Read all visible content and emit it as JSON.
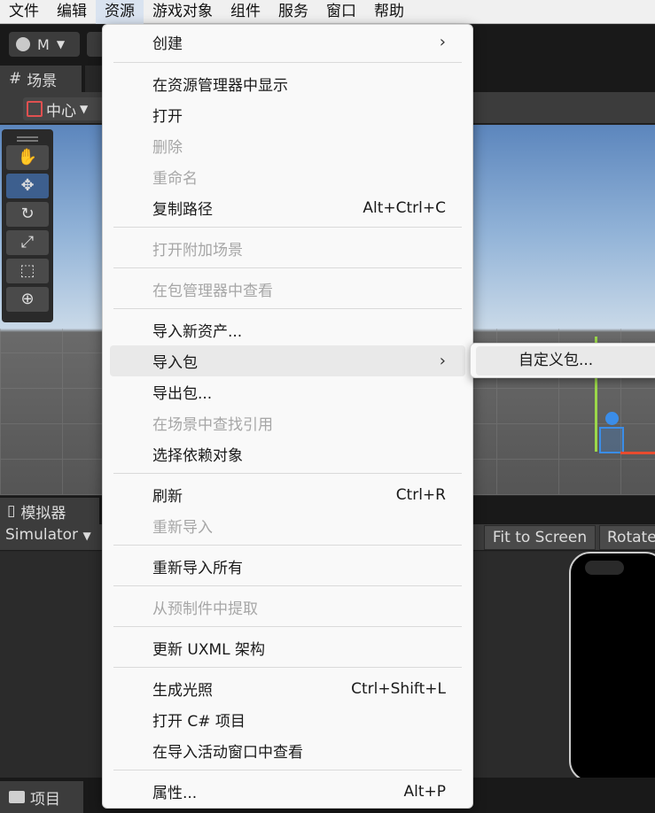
{
  "menubar": {
    "items": [
      "文件",
      "编辑",
      "资源",
      "游戏对象",
      "组件",
      "服务",
      "窗口",
      "帮助"
    ],
    "open_index": 2
  },
  "toolbar": {
    "account_label": "M"
  },
  "scene": {
    "tab_label": "场景",
    "pivot_label": "中心"
  },
  "simulator": {
    "tab_label": "模拟器",
    "selector": "Simulator",
    "fit_label": "Fit to Screen",
    "rotate_label": "Rotate"
  },
  "project": {
    "tab_label": "项目"
  },
  "context_menu": {
    "items": [
      {
        "label": "创建",
        "shortcut": "",
        "submenu": true,
        "disabled": false
      },
      {
        "label": "在资源管理器中显示",
        "shortcut": "",
        "submenu": false,
        "disabled": false
      },
      {
        "label": "打开",
        "shortcut": "",
        "submenu": false,
        "disabled": false
      },
      {
        "label": "删除",
        "shortcut": "",
        "submenu": false,
        "disabled": true
      },
      {
        "label": "重命名",
        "shortcut": "",
        "submenu": false,
        "disabled": true
      },
      {
        "label": "复制路径",
        "shortcut": "Alt+Ctrl+C",
        "submenu": false,
        "disabled": false
      },
      {
        "label": "打开附加场景",
        "shortcut": "",
        "submenu": false,
        "disabled": true
      },
      {
        "label": "在包管理器中查看",
        "shortcut": "",
        "submenu": false,
        "disabled": true
      },
      {
        "label": "导入新资产...",
        "shortcut": "",
        "submenu": false,
        "disabled": false
      },
      {
        "label": "导入包",
        "shortcut": "",
        "submenu": true,
        "disabled": false,
        "highlighted": true
      },
      {
        "label": "导出包...",
        "shortcut": "",
        "submenu": false,
        "disabled": false
      },
      {
        "label": "在场景中查找引用",
        "shortcut": "",
        "submenu": false,
        "disabled": true
      },
      {
        "label": "选择依赖对象",
        "shortcut": "",
        "submenu": false,
        "disabled": false
      },
      {
        "label": "刷新",
        "shortcut": "Ctrl+R",
        "submenu": false,
        "disabled": false
      },
      {
        "label": "重新导入",
        "shortcut": "",
        "submenu": false,
        "disabled": true
      },
      {
        "label": "重新导入所有",
        "shortcut": "",
        "submenu": false,
        "disabled": false
      },
      {
        "label": "从预制件中提取",
        "shortcut": "",
        "submenu": false,
        "disabled": true
      },
      {
        "label": "更新 UXML 架构",
        "shortcut": "",
        "submenu": false,
        "disabled": false
      },
      {
        "label": "生成光照",
        "shortcut": "Ctrl+Shift+L",
        "submenu": false,
        "disabled": false
      },
      {
        "label": "打开 C# 项目",
        "shortcut": "",
        "submenu": false,
        "disabled": false
      },
      {
        "label": "在导入活动窗口中查看",
        "shortcut": "",
        "submenu": false,
        "disabled": false
      },
      {
        "label": "属性...",
        "shortcut": "Alt+P",
        "submenu": false,
        "disabled": false
      }
    ]
  },
  "submenu": {
    "items": [
      "自定义包..."
    ]
  }
}
